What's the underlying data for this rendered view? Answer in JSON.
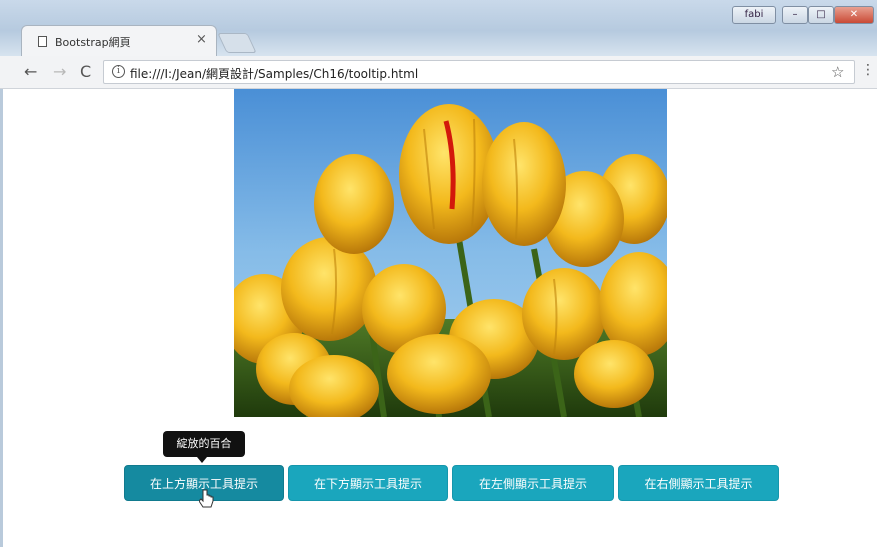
{
  "browser": {
    "tab_title": "Bootstrap網頁",
    "tab_close": "×",
    "window_user_label": "fabi",
    "window_min": "–",
    "window_max": "□",
    "window_close": "✕",
    "url": "file:///I:/Jean/網頁設計/Samples/Ch16/tooltip.html",
    "back": "←",
    "forward": "→",
    "reload": "C",
    "info": "i",
    "bookmark": "☆",
    "menu": "⋮"
  },
  "page": {
    "tooltip_text": "綻放的百合",
    "buttons": [
      {
        "label": "在上方顯示工具提示",
        "state": "active"
      },
      {
        "label": "在下方顯示工具提示",
        "state": "normal"
      },
      {
        "label": "在左側顯示工具提示",
        "state": "normal"
      },
      {
        "label": "在右側顯示工具提示",
        "state": "normal"
      }
    ],
    "button_color": "#1aa6bd",
    "image": {
      "subject": "yellow tulips against blue sky",
      "icon": "photo"
    }
  }
}
